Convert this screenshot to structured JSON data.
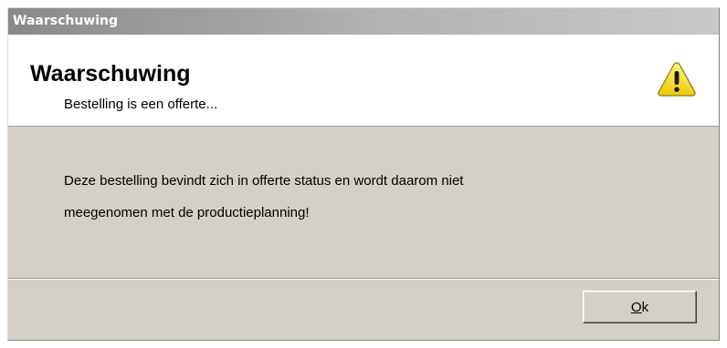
{
  "window": {
    "title": "Waarschuwing"
  },
  "header": {
    "title": "Waarschuwing",
    "subtitle": "Bestelling is een offerte...",
    "icon": "warning-icon"
  },
  "message": {
    "line1": "Deze bestelling bevindt zich in offerte status en wordt daarom niet",
    "line2": "meegenomen met de productieplanning!"
  },
  "buttons": {
    "ok_mnemonic": "O",
    "ok_rest": "k"
  },
  "colors": {
    "dialog_background": "#d4d0c8",
    "header_background": "#ffffff",
    "warning_yellow": "#f5d800"
  }
}
